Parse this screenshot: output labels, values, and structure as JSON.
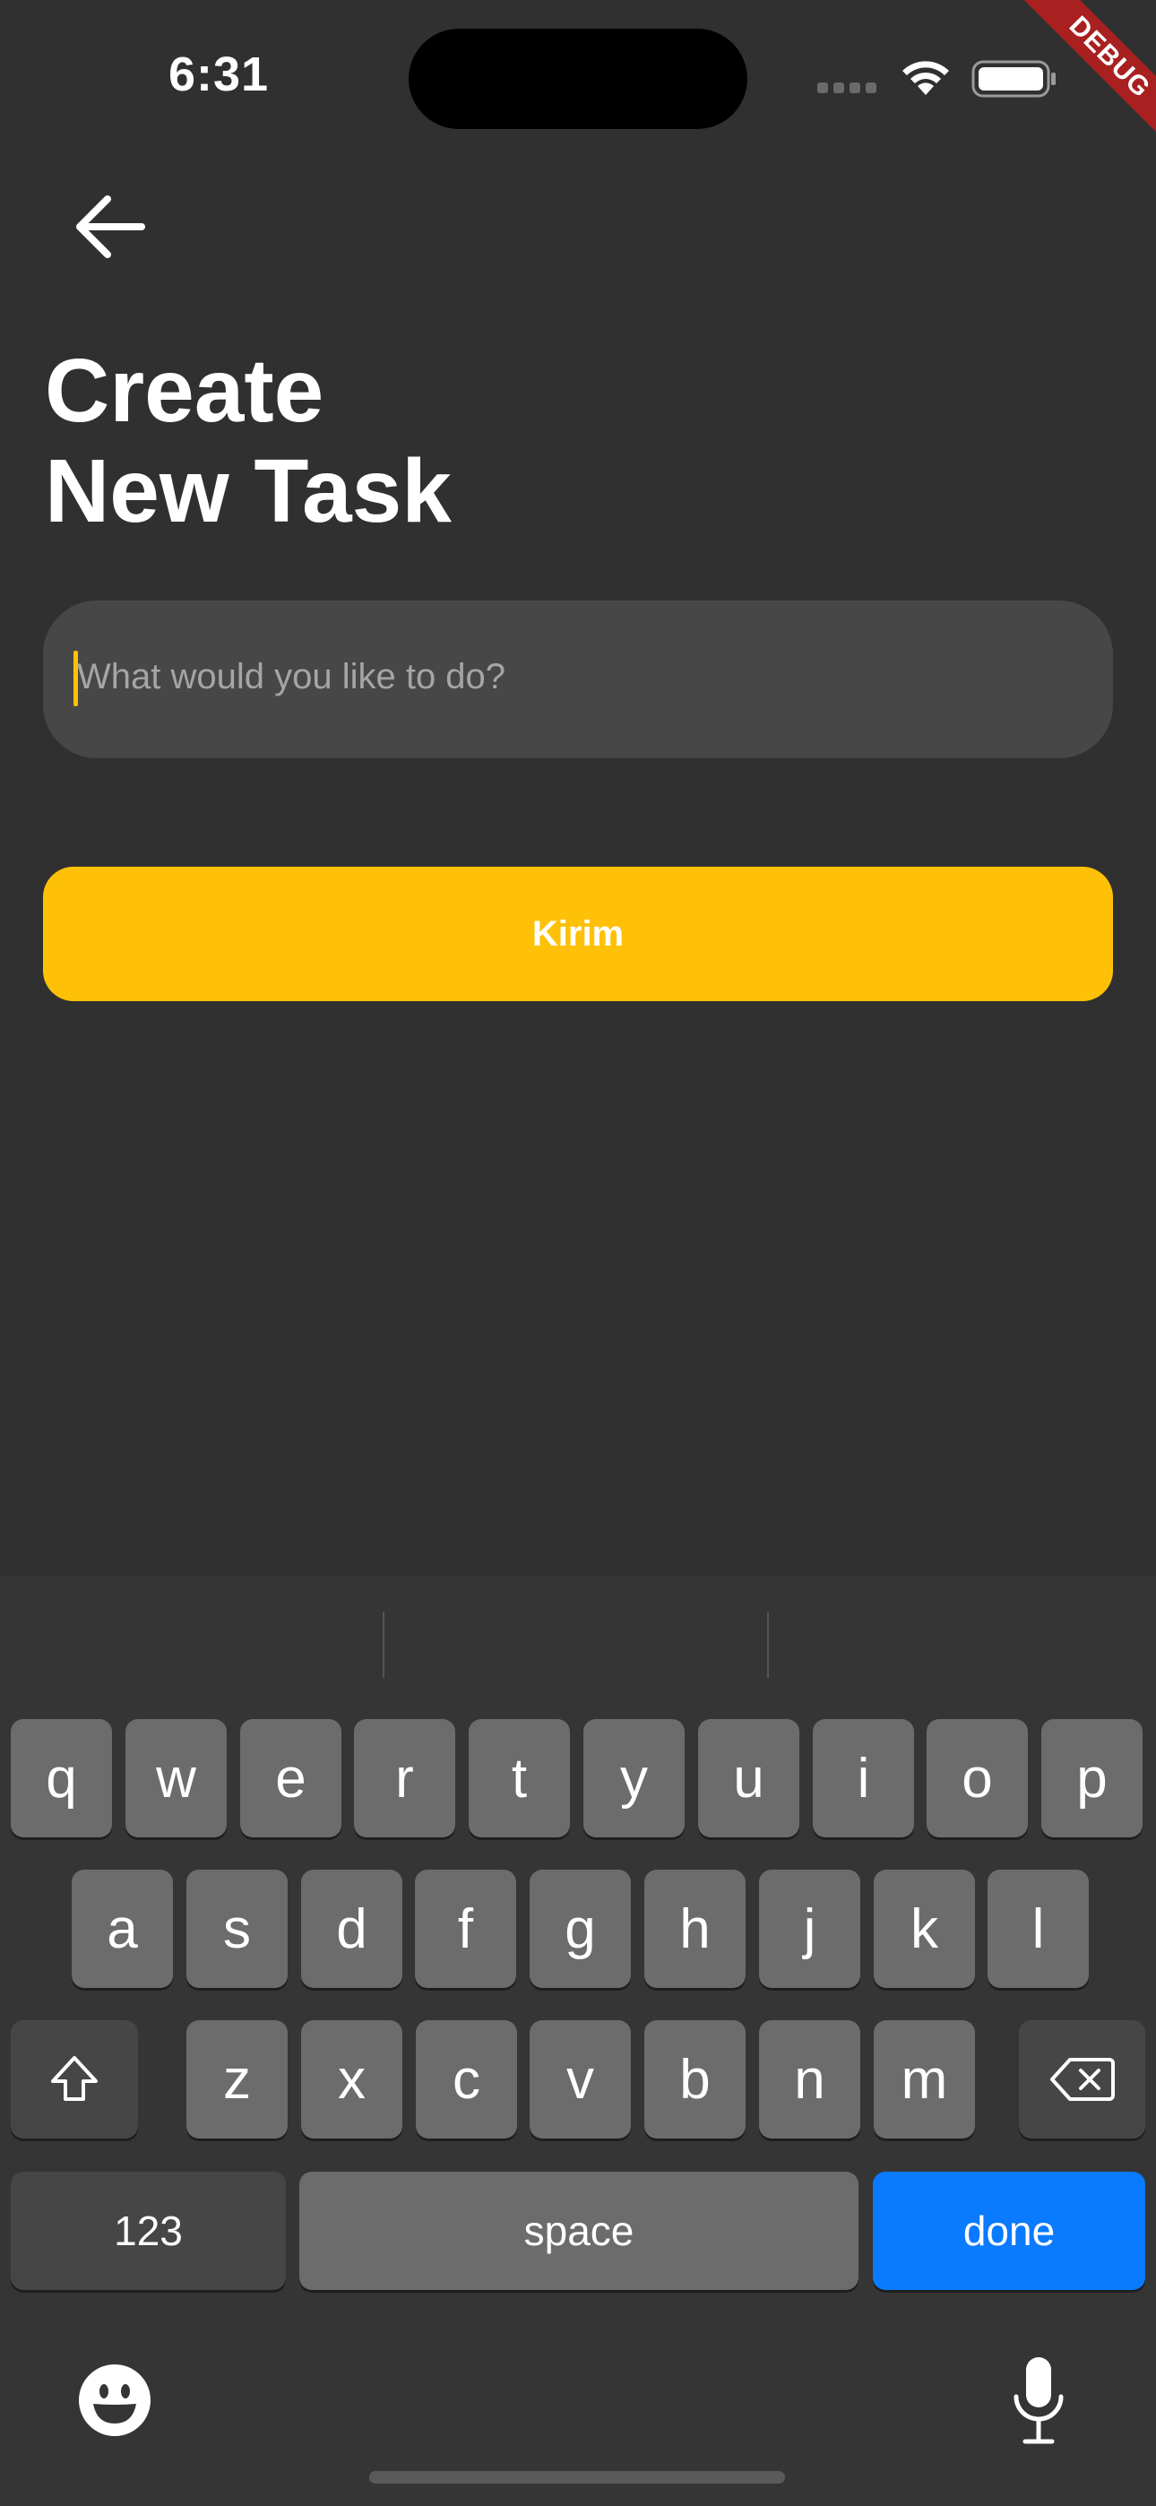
{
  "status_bar": {
    "time": "6:31"
  },
  "debug_banner": "DEBUG",
  "header": {
    "title_line1": "Create",
    "title_line2": "New Task"
  },
  "task_input": {
    "placeholder": "What would you like to do?",
    "value": ""
  },
  "submit_button": {
    "label": "Kirim",
    "color": "#ffc107"
  },
  "keyboard": {
    "row1": [
      "q",
      "w",
      "e",
      "r",
      "t",
      "y",
      "u",
      "i",
      "o",
      "p"
    ],
    "row2": [
      "a",
      "s",
      "d",
      "f",
      "g",
      "h",
      "j",
      "k",
      "l"
    ],
    "row3": [
      "z",
      "x",
      "c",
      "v",
      "b",
      "n",
      "m"
    ],
    "numbers_label": "123",
    "space_label": "space",
    "done_label": "done",
    "done_color": "#0a7aff"
  },
  "icons": {
    "back": "arrow-left-icon",
    "shift": "shift-icon",
    "delete": "backspace-icon",
    "emoji": "emoji-icon",
    "mic": "microphone-icon",
    "wifi": "wifi-icon",
    "battery": "battery-icon"
  }
}
